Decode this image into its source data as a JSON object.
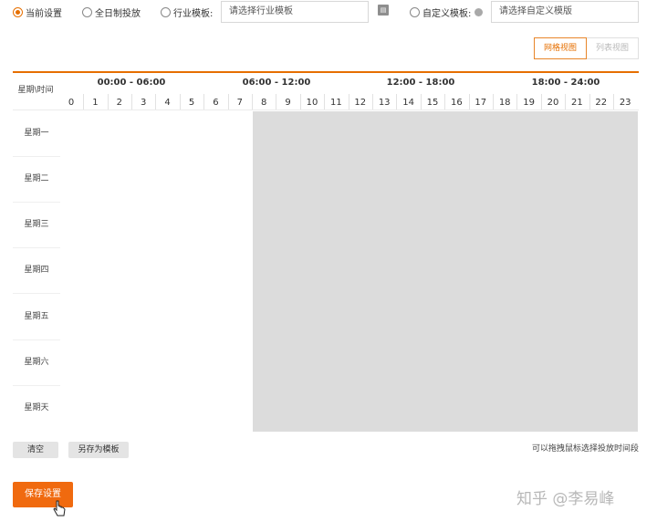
{
  "top_options": {
    "current": "当前设置",
    "all_day": "全日制投放",
    "industry": "行业模板:",
    "industry_placeholder": "请选择行业模板",
    "custom": "自定义模板:",
    "custom_placeholder": "请选择自定义模版"
  },
  "view_toggle": {
    "grid": "网格视图",
    "list": "列表视图"
  },
  "grid": {
    "corner": "星期\\时间",
    "groups": [
      "00:00 - 06:00",
      "06:00 - 12:00",
      "12:00 - 18:00",
      "18:00 - 24:00"
    ],
    "hours": [
      "0",
      "1",
      "2",
      "3",
      "4",
      "5",
      "6",
      "7",
      "8",
      "9",
      "10",
      "11",
      "12",
      "13",
      "14",
      "15",
      "16",
      "17",
      "18",
      "19",
      "20",
      "21",
      "22",
      "23"
    ],
    "days": [
      "星期一",
      "星期二",
      "星期三",
      "星期四",
      "星期五",
      "星期六",
      "星期天"
    ]
  },
  "bottom": {
    "clear": "清空",
    "save_template": "另存为模板",
    "hint": "可以拖拽鼠标选择投放时间段",
    "save": "保存设置"
  },
  "watermark": "知乎 @李易峰",
  "colors": {
    "accent": "#e66f00",
    "button": "#f06a0f",
    "selected": "#dcdcdc"
  }
}
